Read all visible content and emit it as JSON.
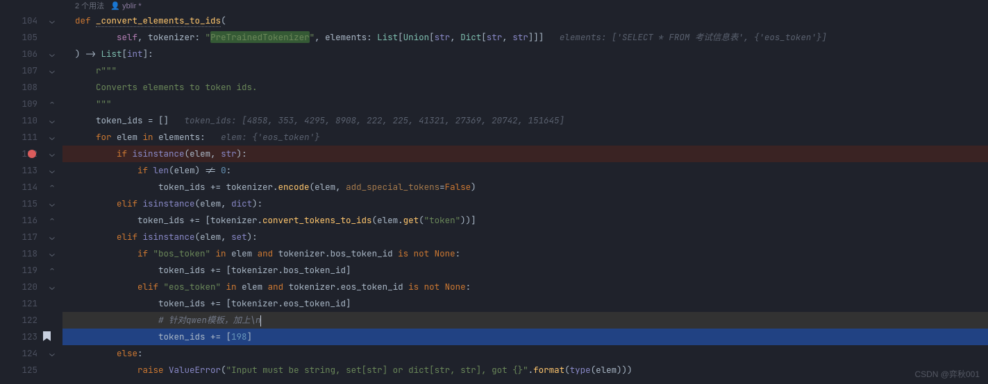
{
  "meta": {
    "usages": "2 个用法",
    "author_icon": "👤",
    "author": "yblir *"
  },
  "line_numbers": [
    "104",
    "105",
    "106",
    "107",
    "108",
    "109",
    "110",
    "111",
    "112",
    "113",
    "114",
    "115",
    "116",
    "117",
    "118",
    "119",
    "120",
    "121",
    "122",
    "123",
    "124",
    "125"
  ],
  "code": {
    "l104": {
      "def": "def ",
      "fn": "_convert_elements_to_ids",
      "open": "("
    },
    "l105": {
      "self": "self",
      "c1": ", tokenizer: ",
      "q1": "\"",
      "type": "PreTrainedTokenizer",
      "q2": "\"",
      "c2": ", elements: ",
      "t1": "List",
      "b1": "[",
      "t2": "Union",
      "b2": "[",
      "t3": "str",
      "c3": ", ",
      "t4": "Dict",
      "b3": "[",
      "t5": "str",
      "c4": ", ",
      "t6": "str",
      "close": "]]]",
      "hint": "elements: ['SELECT * FROM 考试信息表', {'eos_token'}]"
    },
    "l106": {
      "close": ") -> ",
      "t1": "List",
      "b1": "[",
      "t2": "int",
      "b2": "]:"
    },
    "l107": {
      "doc": "r\"\"\""
    },
    "l108": {
      "doc": "Converts elements to token ids."
    },
    "l109": {
      "doc": "\"\"\""
    },
    "l110": {
      "var": "token_ids = []",
      "hint": "token_ids: [4858, 353, 4295, 8908, 222, 225, 41321, 27369, 20742, 151645]"
    },
    "l111": {
      "for": "for ",
      "var": "elem ",
      "in": "in ",
      "it": "elements:",
      "hint": "elem: {'eos_token'}"
    },
    "l112": {
      "if": "if ",
      "fn": "isinstance",
      "open": "(",
      "arg": "elem, ",
      "t": "str",
      "close": "):"
    },
    "l113": {
      "if": "if ",
      "fn": "len",
      "open": "(",
      "arg": "elem) != ",
      "num": "0",
      "close": ":"
    },
    "l114": {
      "var": "token_ids += tokenizer.",
      "m": "encode",
      "open": "(",
      "arg": "elem, ",
      "kw": "add_special_tokens",
      "eq": "=",
      "val": "False",
      "close": ")"
    },
    "l115": {
      "elif": "elif ",
      "fn": "isinstance",
      "open": "(",
      "arg": "elem, ",
      "t": "dict",
      "close": "):"
    },
    "l116": {
      "var": "token_ids += [tokenizer.",
      "m": "convert_tokens_to_ids",
      "open": "(",
      "arg": "elem.",
      "m2": "get",
      "open2": "(",
      "str": "\"token\"",
      "close": "))]"
    },
    "l117": {
      "elif": "elif ",
      "fn": "isinstance",
      "open": "(",
      "arg": "elem, ",
      "t": "set",
      "close": "):"
    },
    "l118": {
      "if": "if ",
      "str": "\"bos_token\"",
      "in": " in ",
      "var": "elem ",
      "and": "and ",
      "tok": "tokenizer.bos_token_id ",
      "is": "is not ",
      "none": "None",
      "close": ":"
    },
    "l119": {
      "var": "token_ids += [tokenizer.bos_token_id]"
    },
    "l120": {
      "elif": "elif ",
      "str": "\"eos_token\"",
      "in": " in ",
      "var": "elem ",
      "and": "and ",
      "tok": "tokenizer.eos_token_id ",
      "is": "is not ",
      "none": "None",
      "close": ":"
    },
    "l121": {
      "var": "token_ids += [tokenizer.eos_token_id]"
    },
    "l122": {
      "comment": "# 针对qwen模板，加上\\n"
    },
    "l123": {
      "var": "token_ids += [",
      "num": "198",
      "close": "]"
    },
    "l124": {
      "else": "else",
      "close": ":"
    },
    "l125": {
      "raise": "raise ",
      "err": "ValueError",
      "open": "(",
      "str": "\"Input must be string, set[str] or dict[str, str], got {}\"",
      "dot": ".",
      "fmt": "format",
      "open2": "(",
      "type": "type",
      "open3": "(",
      "arg": "elem)))"
    }
  },
  "watermark": "CSDN @弈秋001"
}
